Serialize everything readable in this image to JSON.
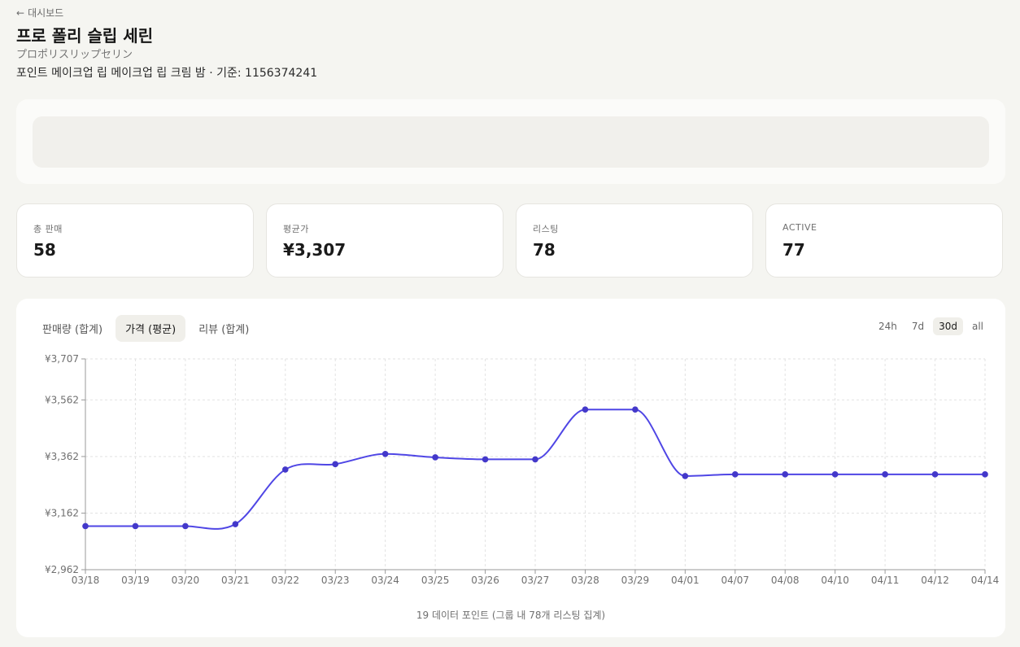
{
  "nav": {
    "back_label": "대시보드"
  },
  "product": {
    "title": "프로 폴리 슬립 세린",
    "subtitle": "プロポリスリップセリン",
    "meta": "포인트 메이크업 립 메이크업 립 크림 밤 · 기준: 1156374241"
  },
  "stats": [
    {
      "label": "총 판매",
      "value": "58"
    },
    {
      "label": "평균가",
      "value": "¥3,307"
    },
    {
      "label": "리스팅",
      "value": "78"
    },
    {
      "label": "ACTIVE",
      "value": "77"
    }
  ],
  "chart_panel": {
    "metric_tabs": [
      "판매량 (합계)",
      "가격 (평균)",
      "리뷰 (합계)"
    ],
    "active_metric": 1,
    "range_tabs": [
      "24h",
      "7d",
      "30d",
      "all"
    ],
    "active_range": 2,
    "footer": "19 데이터 포인트 (그룹 내 78개 리스팅 집계)"
  },
  "colors": {
    "line": "#4f46e5",
    "point": "#4338ca"
  },
  "chart_data": {
    "type": "line",
    "categories": [
      "03/18",
      "03/19",
      "03/20",
      "03/21",
      "03/22",
      "03/23",
      "03/24",
      "03/25",
      "03/26",
      "03/27",
      "03/28",
      "03/29",
      "04/01",
      "04/07",
      "04/08",
      "04/10",
      "04/11",
      "04/12",
      "04/14"
    ],
    "series": [
      {
        "values": [
          3116,
          3116,
          3116,
          3123,
          3316,
          3335,
          3371,
          3359,
          3352,
          3352,
          3528,
          3528,
          3293,
          3299,
          3299,
          3299,
          3299,
          3299,
          3299
        ]
      }
    ],
    "yticks": [
      "¥2,962",
      "¥3,162",
      "¥3,362",
      "¥3,562",
      "¥3,707"
    ],
    "ytick_values": [
      2962,
      3162,
      3362,
      3562,
      3707
    ],
    "ylim": [
      2962,
      3707
    ],
    "grid": true,
    "curve": "smooth"
  }
}
